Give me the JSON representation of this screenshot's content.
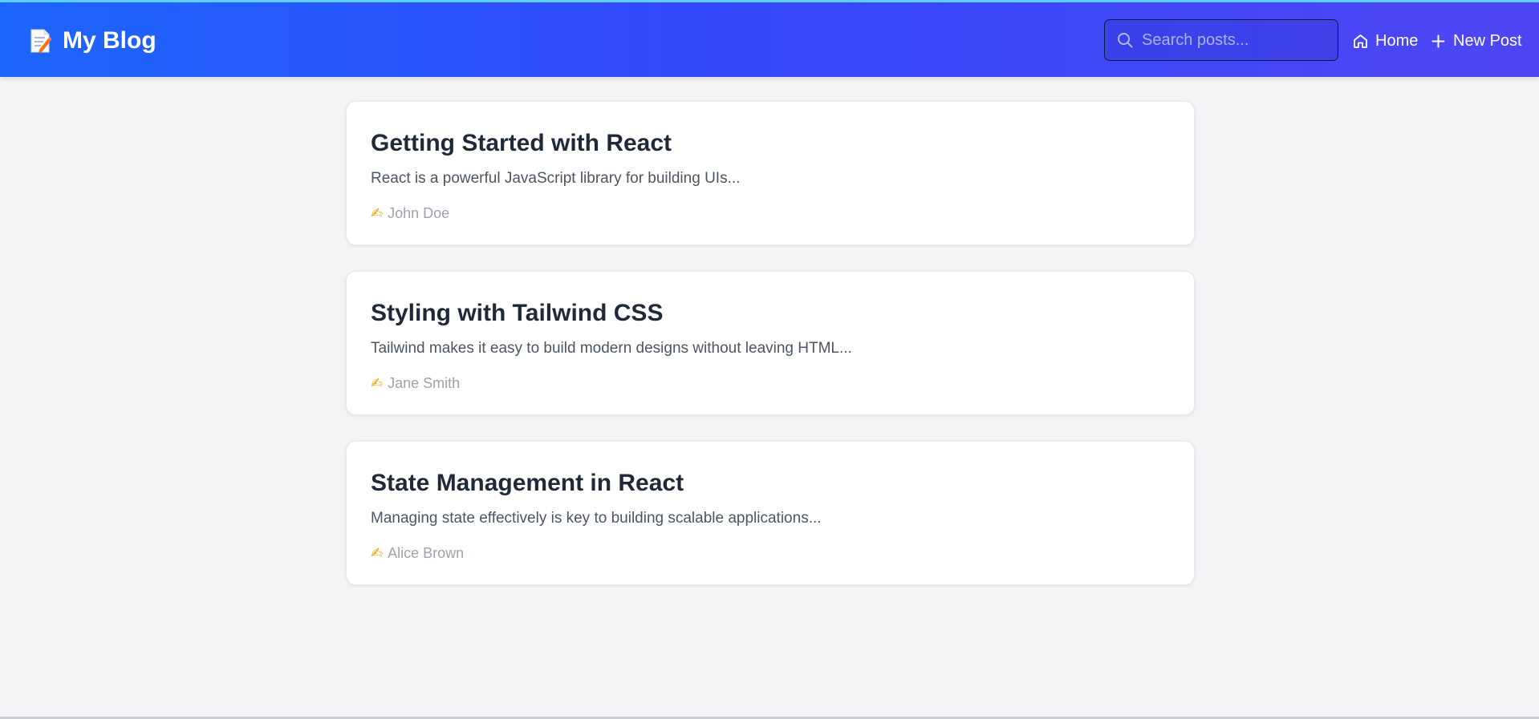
{
  "header": {
    "brand_icon": "memo-icon",
    "title": "My Blog",
    "search": {
      "placeholder": "Search posts...",
      "value": ""
    },
    "nav": [
      {
        "icon": "home-icon",
        "label": "Home"
      },
      {
        "icon": "plus-icon",
        "label": "New Post"
      }
    ]
  },
  "posts": [
    {
      "title": "Getting Started with React",
      "excerpt": "React is a powerful JavaScript library for building UIs...",
      "author_icon": "✍",
      "author": "John Doe"
    },
    {
      "title": "Styling with Tailwind CSS",
      "excerpt": "Tailwind makes it easy to build modern designs without leaving HTML...",
      "author_icon": "✍",
      "author": "Jane Smith"
    },
    {
      "title": "State Management in React",
      "excerpt": "Managing state effectively is key to building scalable applications...",
      "author_icon": "✍",
      "author": "Alice Brown"
    }
  ],
  "colors": {
    "header_gradient_start": "#1d66fb",
    "header_gradient_end": "#4f46f3",
    "background": "#f3f4f6",
    "card_title": "#1f2937",
    "card_excerpt": "#4b5563",
    "card_meta": "#9ca3af"
  }
}
